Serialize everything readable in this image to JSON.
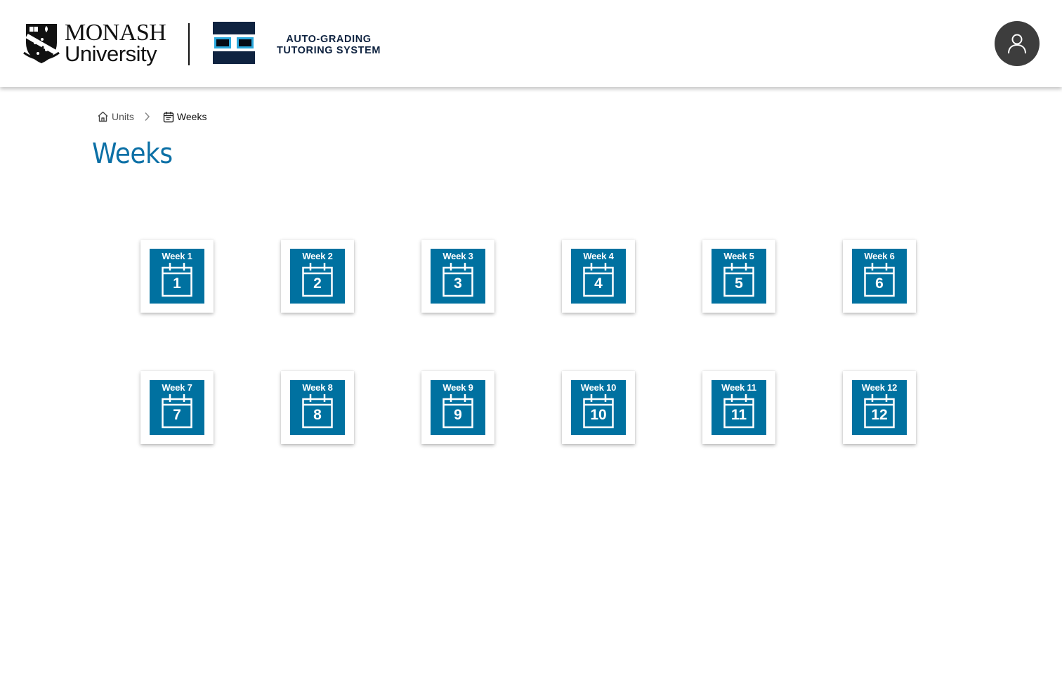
{
  "header": {
    "university": {
      "line1": "MONASH",
      "line2": "University"
    },
    "system": {
      "line1": "AUTO-GRADING",
      "line2": "TUTORING SYSTEM"
    },
    "avatar_icon": "user-icon"
  },
  "breadcrumb": {
    "items": [
      {
        "label": "Units",
        "icon": "home-icon"
      },
      {
        "label": "Weeks",
        "icon": "calendar-icon"
      }
    ],
    "separator_icon": "chevron-right-icon"
  },
  "page": {
    "title": "Weeks"
  },
  "weeks": [
    {
      "label": "Week 1",
      "number": "1"
    },
    {
      "label": "Week 2",
      "number": "2"
    },
    {
      "label": "Week 3",
      "number": "3"
    },
    {
      "label": "Week 4",
      "number": "4"
    },
    {
      "label": "Week 5",
      "number": "5"
    },
    {
      "label": "Week 6",
      "number": "6"
    },
    {
      "label": "Week 7",
      "number": "7"
    },
    {
      "label": "Week 8",
      "number": "8"
    },
    {
      "label": "Week 9",
      "number": "9"
    },
    {
      "label": "Week 10",
      "number": "10"
    },
    {
      "label": "Week 11",
      "number": "11"
    },
    {
      "label": "Week 12",
      "number": "12"
    }
  ],
  "colors": {
    "accent": "#0c70a6",
    "tile": "#0071a0",
    "navy": "#0f2340",
    "avatar_bg": "#3d3d3d"
  }
}
